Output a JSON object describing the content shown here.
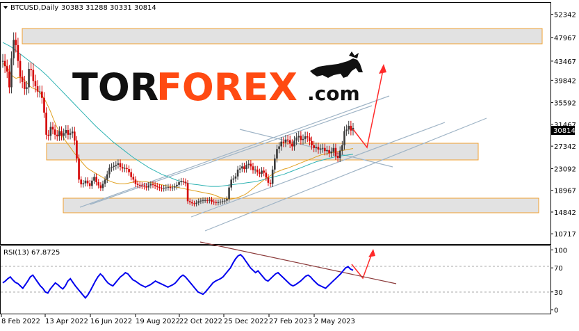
{
  "header": {
    "symbol": "BTCUSD,Daily",
    "ohlc": "30383 31288 30331 30814"
  },
  "price_badge": "30814",
  "watermark": {
    "brand_a": "TOR",
    "brand_b": "FOREX",
    "brand_c": ".com",
    "color_dark": "#111111",
    "color_accent": "#ff4a12"
  },
  "rsi_panel": {
    "label": "RSI(13) 67.8725",
    "levels": [
      100,
      70,
      30,
      0
    ]
  },
  "colors": {
    "bull_candle": "#3a3a3a",
    "bear_candle": "#d40000",
    "ma_fast": "#e0a020",
    "ma_slow": "#2fb3b3",
    "channel": "#9fb4c6",
    "zone_fill": "#e2e2e2",
    "zone_border": "#f0a030",
    "forecast_arrow": "#ff2a2a",
    "rsi_line": "#0000ee",
    "rsi_trendline": "#8b3a3a"
  },
  "chart_data": [
    {
      "type": "line",
      "title": "BTCUSD,Daily",
      "y_ticks": [
        52342,
        47967,
        43467,
        39842,
        35592,
        31467,
        27342,
        23092,
        18967,
        14842,
        10717
      ],
      "x_ticks": [
        "8 Feb 2022",
        "13 Apr 2022",
        "16 Jun 2022",
        "19 Aug 2022",
        "22 Oct 2022",
        "25 Dec 2022",
        "27 Feb 2023",
        "2 May 2023"
      ],
      "ylim": [
        8900,
        54400
      ],
      "xlim": [
        -5,
        555
      ],
      "close_series_daily": [
        43500,
        42500,
        41500,
        38500,
        44000,
        47500,
        46500,
        43500,
        40500,
        39500,
        38200,
        38500,
        42000,
        41800,
        39700,
        38700,
        37700,
        37700,
        36500,
        33700,
        29500,
        29300,
        31000,
        30500,
        29500,
        29200,
        30200,
        29300,
        29800,
        30400,
        29500,
        29800,
        30100,
        28400,
        25000,
        21000,
        20100,
        20300,
        20800,
        20300,
        19800,
        20800,
        21500,
        20500,
        19900,
        19400,
        20200,
        21000,
        22000,
        23200,
        23400,
        23600,
        23800,
        24100,
        23400,
        23100,
        23200,
        23000,
        22400,
        21500,
        21000,
        20200,
        20000,
        19900,
        19800,
        19700,
        19500,
        19900,
        20100,
        20000,
        19800,
        19600,
        19400,
        19300,
        19400,
        19500,
        19600,
        19400,
        19500,
        19700,
        20000,
        20500,
        20700,
        20600,
        20300,
        16900,
        16700,
        16500,
        16400,
        16600,
        16900,
        17000,
        17100,
        17100,
        17000,
        17200,
        16800,
        16700,
        16600,
        16700,
        16800,
        16900,
        17000,
        17300,
        19500,
        21000,
        21200,
        21600,
        22900,
        23100,
        23500,
        23000,
        23800,
        24000,
        23500,
        22800,
        22900,
        22400,
        22100,
        22700,
        22300,
        21400,
        20400,
        20200,
        22900,
        25000,
        26800,
        27300,
        28200,
        28000,
        28600,
        28500,
        27800,
        27300,
        28400,
        29000,
        29300,
        28500,
        28700,
        29200,
        29000,
        28300,
        27500,
        27000,
        27200,
        26700,
        26900,
        27000,
        26400,
        26600,
        26000,
        26300,
        27000,
        25500,
        25100,
        26500,
        27500,
        30200,
        30500,
        31200,
        30300,
        30800
      ],
      "series": [
        {
          "name": "",
          "values": [
            43500,
            42500,
            41500,
            38500,
            44000,
            47500,
            46500,
            43500,
            40500,
            39500,
            38200,
            38500,
            42000,
            41800,
            39700,
            38700,
            37700,
            37700,
            36500,
            33700,
            29500,
            29300,
            31000,
            30500,
            29500,
            29200,
            30200,
            29300,
            29800,
            30400,
            29500,
            29800,
            30100,
            28400,
            25000,
            21000,
            20100,
            20300,
            20800,
            20300,
            19800,
            20800,
            21500,
            20500,
            19900,
            19400,
            20200,
            21000,
            22000,
            23200,
            23400,
            23600,
            23800,
            24100,
            23400,
            23100,
            23200,
            23000,
            22400,
            21500,
            21000,
            20200,
            20000,
            19900,
            19800,
            19700,
            19500,
            19900,
            20100,
            20000,
            19800,
            19600,
            19400,
            19300,
            19400,
            19500,
            19600,
            19400,
            19500,
            19700,
            20000,
            20500,
            20700,
            20600,
            20300,
            16900,
            16700,
            16500,
            16400,
            16600,
            16900,
            17000,
            17100,
            17100,
            17000,
            17200,
            16800,
            16700,
            16600,
            16700,
            16800,
            16900,
            17000,
            17300,
            19500,
            21000,
            21200,
            21600,
            22900,
            23100,
            23500,
            23000,
            23800,
            24000,
            23500,
            22800,
            22900,
            22400,
            22100,
            22700,
            22300,
            21400,
            20400,
            20200,
            22900,
            25000,
            26800,
            27300,
            28200,
            28000,
            28600,
            28500,
            27800,
            27300,
            28400,
            29000,
            29300,
            28500,
            28700,
            29200,
            29000,
            28300,
            27500,
            27000,
            27200,
            26700,
            26900,
            27000,
            26400,
            26600,
            26000,
            26300,
            27000,
            25500,
            25100,
            26500,
            27500,
            30200,
            30500,
            31200,
            30300,
            30800
          ]
        },
        {
          "name": "",
          "values": [
            43000,
            42800,
            42000,
            41000,
            40500,
            40200,
            40400,
            40300,
            40000,
            39400,
            38800,
            38400,
            38200,
            38000,
            37500,
            36800,
            36000,
            35000,
            33900,
            32600,
            31400,
            30300,
            29500,
            28800,
            28100,
            27400,
            26700,
            26000,
            25400,
            24800,
            24200,
            23600,
            23100,
            22800,
            22500,
            22200,
            21900,
            21600,
            21300,
            21000,
            20800,
            20600,
            20400,
            20300,
            20200,
            20200,
            20200,
            20300,
            20400,
            20500,
            20600,
            20700,
            20700,
            20700,
            20600,
            20500,
            20400,
            20300,
            20200,
            20100,
            20000,
            19900,
            19800,
            19700,
            19700,
            19600,
            19500,
            19400,
            19300,
            19200,
            19100,
            19000,
            18900,
            18800,
            18700,
            18600,
            18500,
            18400,
            18300,
            18200,
            18000,
            17800,
            17600,
            17500,
            17400,
            17300,
            17300,
            17400,
            17500,
            17700,
            17900,
            18100,
            18400,
            18800,
            19200,
            19600,
            20000,
            20400,
            20800,
            21200,
            21500,
            21800,
            22100,
            22400,
            22600,
            22800,
            23000,
            23100,
            23300,
            23500,
            23700,
            23900,
            24100,
            24300,
            24500,
            24700,
            24900,
            25100,
            25300,
            25500,
            25700,
            25800,
            25900,
            26000,
            26100,
            26200,
            26300,
            26400,
            26500,
            26600,
            26700,
            26800,
            26900
          ]
        },
        {
          "name": "",
          "values": [
            47000,
            46600,
            46200,
            45600,
            45000,
            44400,
            43800,
            43200,
            42600,
            42000,
            41300,
            40600,
            39800,
            39000,
            38200,
            37400,
            36600,
            35800,
            35000,
            34200,
            33400,
            32600,
            31800,
            31000,
            30300,
            29600,
            28900,
            28200,
            27600,
            27000,
            26400,
            25800,
            25200,
            24700,
            24200,
            23700,
            23200,
            22800,
            22400,
            22000,
            21700,
            21400,
            21100,
            20800,
            20600,
            20400,
            20200,
            20100,
            20000,
            19900,
            19800,
            19700,
            19700,
            19700,
            19800,
            19900,
            20000,
            20100,
            20200,
            20300,
            20400,
            20500,
            20600,
            20800,
            21000,
            21200,
            21400,
            21600,
            21800,
            22000,
            22300,
            22600,
            22900,
            23200,
            23500,
            23800,
            24100,
            24400,
            24600,
            24800,
            25000,
            25200,
            25400,
            25500,
            25600,
            25700,
            25800
          ]
        }
      ],
      "series_y_ranges": [
        [
          8900,
          54400
        ],
        [
          8900,
          54400
        ],
        [
          8900,
          54400
        ]
      ]
    },
    {
      "type": "line",
      "title": "RSI(13) 67.8725",
      "y_ticks": [
        100,
        70,
        30,
        0
      ],
      "ylim": [
        -5,
        105
      ],
      "levels": [
        70,
        30
      ],
      "series": [
        {
          "name": "",
          "values": [
            45,
            48,
            52,
            55,
            50,
            46,
            44,
            40,
            36,
            42,
            48,
            55,
            58,
            52,
            46,
            40,
            36,
            30,
            28,
            35,
            40,
            45,
            42,
            38,
            35,
            40,
            48,
            52,
            46,
            40,
            35,
            30,
            25,
            20,
            25,
            32,
            40,
            48,
            55,
            60,
            56,
            50,
            45,
            42,
            40,
            45,
            50,
            55,
            58,
            62,
            60,
            55,
            50,
            48,
            45,
            42,
            40,
            38,
            40,
            42,
            45,
            48,
            46,
            44,
            42,
            40,
            38,
            40,
            42,
            45,
            50,
            55,
            58,
            55,
            50,
            45,
            40,
            35,
            30,
            28,
            26,
            30,
            35,
            40,
            45,
            48,
            50,
            52,
            55,
            60,
            65,
            70,
            78,
            85,
            90,
            92,
            88,
            82,
            76,
            70,
            66,
            62,
            65,
            60,
            55,
            50,
            48,
            52,
            56,
            60,
            62,
            58,
            54,
            50,
            46,
            42,
            40,
            42,
            45,
            48,
            52,
            56,
            58,
            55,
            50,
            46,
            42,
            40,
            38,
            36,
            40,
            44,
            48,
            52,
            56,
            60,
            65,
            70,
            72,
            68,
            66
          ]
        }
      ]
    }
  ]
}
